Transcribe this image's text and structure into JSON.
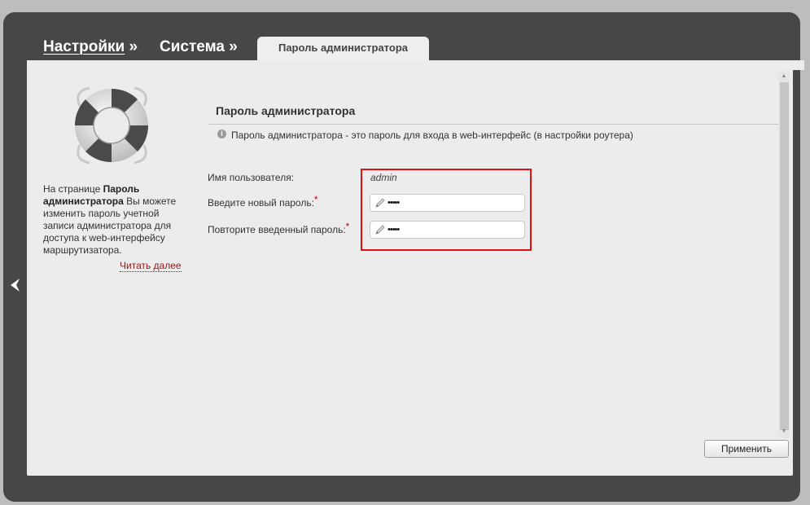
{
  "breadcrumb": {
    "item1": "Настройки",
    "sep1": "»",
    "item2": "Система",
    "sep2": "»"
  },
  "tab": {
    "label": "Пароль администратора"
  },
  "sidebar": {
    "icon": "lifebuoy-icon",
    "help_prefix": "На странице ",
    "help_bold": "Пароль администратора",
    "help_suffix": " Вы можете изменить пароль учетной записи администратора для доступа к web-интерфейсу маршрутизатора.",
    "read_more": "Читать далее"
  },
  "main": {
    "section_title": "Пароль администратора",
    "info_text": "Пароль администратора - это пароль для входа в web-интерфейс (в настройки роутера)",
    "fields": {
      "username_label": "Имя пользователя:",
      "username_value": "admin",
      "new_password_label": "Введите новый пароль:",
      "new_password_value": "•••••",
      "confirm_password_label": "Повторите введенный пароль:",
      "confirm_password_value": "•••••",
      "required_mark": "*"
    },
    "apply_button": "Применить"
  },
  "colors": {
    "frame": "#474747",
    "panel": "#ececec",
    "highlight": "#dd1111",
    "link": "#8b1c1c"
  }
}
